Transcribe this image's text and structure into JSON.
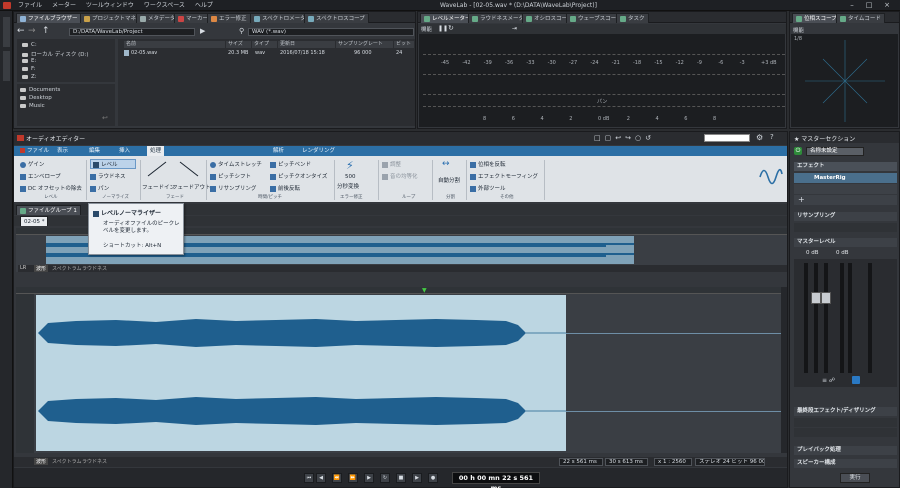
{
  "titlebar": {
    "menu": [
      "ファイル",
      "メーター",
      "ツールウィンドウ",
      "ワークスペース",
      "ヘルプ"
    ],
    "title": "WaveLab - [02-05.wav * (D:\\DATA\\WaveLab\\Project)]"
  },
  "filebrowser": {
    "tabs": [
      "ファイルブラウザー",
      "プロジェクトマネージャー",
      "メタデータ",
      "マーカー",
      "エラー修正",
      "スペクトロメーター",
      "スペクトロスコープ"
    ],
    "path": "D:/DATA/WaveLab/Project",
    "filter": "WAV (*.wav)",
    "tree": [
      "C:",
      "ローカル ディスク (D:)",
      "E:",
      "F:",
      "Z:"
    ],
    "places": [
      "Documents",
      "Desktop",
      "Music"
    ],
    "columns": [
      "名前",
      "サイズ",
      "タイプ",
      "更新日",
      "サンプリングレート",
      "ビット"
    ],
    "files": [
      {
        "name": "02-05.wav",
        "size": "20.3 MB",
        "type": "wav",
        "date": "2016/07/18 15:18",
        "rate": "96 000",
        "bits": "24"
      }
    ]
  },
  "levelmeter": {
    "tabs": [
      "レベルメーター",
      "ラウドネスメーター",
      "オシロスコープ",
      "ウェーブスコープ",
      "タスク"
    ],
    "mode": "機能",
    "scale": [
      "-45",
      "-42",
      "-39",
      "-36",
      "-33",
      "-30",
      "-27",
      "-24",
      "-21",
      "-18",
      "-15",
      "-12",
      "-9",
      "-6",
      "-3",
      "+3 dB"
    ],
    "pan_label": "パン",
    "pan_scale": [
      "8",
      "6",
      "4",
      "2",
      "0 dB",
      "2",
      "4",
      "6",
      "8"
    ]
  },
  "phase": {
    "tabs": [
      "位相スコープ",
      "タイムコード"
    ],
    "mode": "機能",
    "label": "1/8"
  },
  "editor": {
    "title": "オーディオエディター",
    "ribbon_tabs": [
      "ファイル",
      "表示",
      "編集",
      "挿入",
      "処理",
      "解析",
      "レンダリング"
    ],
    "ribbon": {
      "gain": "ゲイン",
      "envelope": "エンベロープ",
      "dc_offset": "DC オフセットの除去",
      "level": "レベル",
      "loudness": "ラウドネス",
      "pan": "パン",
      "fadein": "フェードイン",
      "fadeout": "フェードアウト",
      "timestretch": "タイムストレッチ",
      "pitchshift": "ピッチシフト",
      "resampling": "リサンプリング",
      "pitchbend": "ピッチベンド",
      "pitchquantize": "ピッチクオンタイズ",
      "reverse": "前後反転",
      "convert_rate": "500",
      "convert_label": "分秒変換",
      "tune": "調整",
      "loop_equal": "音の均等化",
      "auto_split": "自動分割",
      "phase_invert": "位相を反転",
      "effect_morph": "エフェクトモーフィング",
      "external": "外部ツール"
    },
    "groups": [
      "レベル",
      "ノーマライズ",
      "フェード",
      "時間/ピッチ",
      "エラー修正",
      "ループ",
      "分割",
      "その他"
    ],
    "tooltip": {
      "title": "レベルノーマライザー",
      "desc": "オーディオファイルのピークレベルを変更します。",
      "shortcut": "ショートカット: Alt+N"
    },
    "file_group": "ファイルグループ 1",
    "file_tab": "02-05 *",
    "view_tabs": [
      "波形",
      "スペクトラム",
      "ラウドネス"
    ],
    "status": {
      "time": "22 s 561 ms",
      "range": "30 s 613 ms",
      "zoom": "x 1 : 2560",
      "format": "ステレオ 24 ビット 96 000 Hz"
    },
    "transport_time": "00 h 00 mn 22 s 561 ms"
  },
  "master": {
    "title": "マスターセクション",
    "preset": "名称未設定",
    "effects_label": "エフェクト",
    "effects_item": "MasterRig",
    "resampling": "リサンプリング",
    "level_label": "マスターレベル",
    "left_db": "0 dB",
    "right_db": "0 dB",
    "final_effects": "最終段エフェクト/ディザリング",
    "playback": "プレイバック処理",
    "speaker": "スピーカー構成",
    "render": "実行"
  },
  "colors": {
    "accent": "#2c6fa5",
    "wave": "#1f5f8e",
    "wave_bg": "#bcd6e2"
  }
}
